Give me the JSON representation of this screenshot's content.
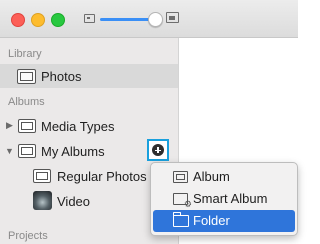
{
  "toolbar": {
    "zoom_slider_value": 0.9,
    "zoom_out_icon": "small-photo-icon",
    "zoom_in_icon": "large-photo-icon"
  },
  "sidebar": {
    "library_header": "Library",
    "library_items": [
      {
        "label": "Photos",
        "icon": "photos-icon",
        "selected": true
      }
    ],
    "albums_header": "Albums",
    "albums_items": [
      {
        "label": "Media Types",
        "icon": "album-icon",
        "expanded": false
      },
      {
        "label": "My Albums",
        "icon": "album-icon",
        "expanded": true
      },
      {
        "label": "Regular Photos",
        "icon": "album-icon"
      },
      {
        "label": "Video",
        "icon": "video-thumbnail"
      }
    ],
    "projects_header": "Projects"
  },
  "add_menu": {
    "items": [
      {
        "label": "Album",
        "icon": "album-icon"
      },
      {
        "label": "Smart Album",
        "icon": "smart-album-icon"
      },
      {
        "label": "Folder",
        "icon": "folder-icon",
        "highlighted": true
      }
    ]
  },
  "colors": {
    "highlight": "#2f75da",
    "add_button_outline": "#1aa0dd",
    "slider_fill": "#3a8ff6"
  }
}
